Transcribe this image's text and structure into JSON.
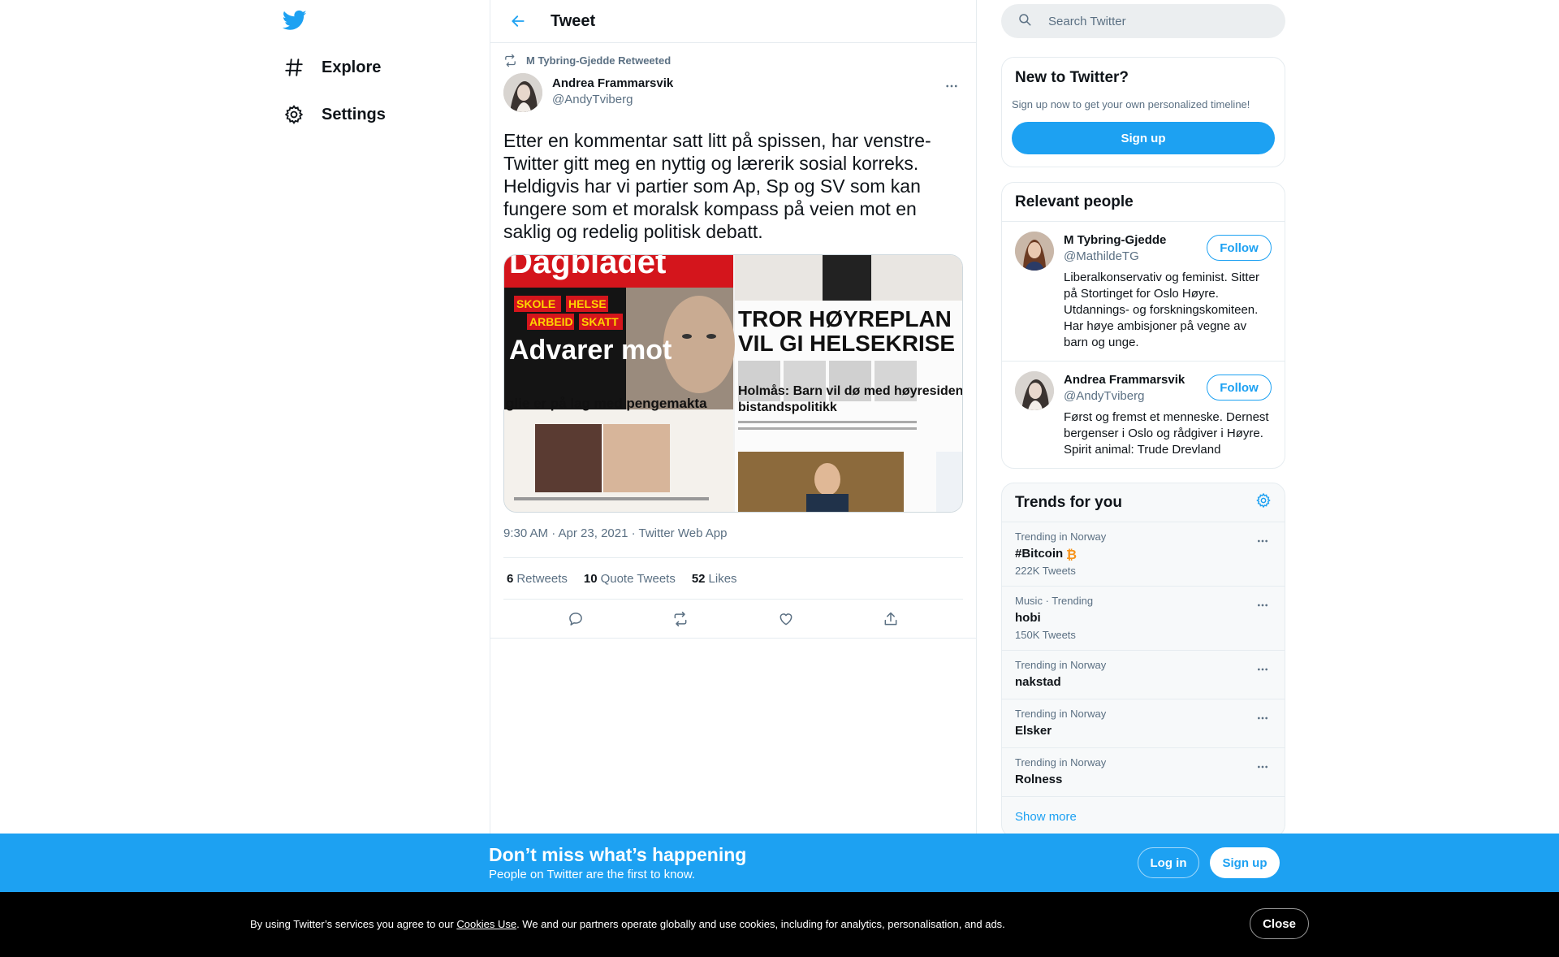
{
  "colors": {
    "brand": "#1da1f2",
    "text": "#0f1419",
    "secondary": "#5b7083",
    "border": "#e6ecf0",
    "bitcoin": "#f7931a"
  },
  "nav": {
    "logo_icon": "twitter-bird-icon",
    "items": [
      {
        "label": "Explore",
        "icon": "hashtag-icon"
      },
      {
        "label": "Settings",
        "icon": "gear-icon"
      }
    ]
  },
  "header": {
    "title": "Tweet",
    "back_icon": "back-arrow-icon"
  },
  "tweet": {
    "retweeted_by": "M Tybring-Gjedde Retweeted",
    "author_name": "Andrea Frammarsvik",
    "author_handle": "@AndyTviberg",
    "text": "Etter en kommentar satt litt på spissen, har venstre-Twitter gitt meg en nyttig og lærerik sosial korreks. Heldigvis har vi partier som Ap, Sp og SV som kan fungere som et moralsk kompass på veien mot en saklig og redelig politisk debatt.",
    "media": {
      "left_masthead": "Dagbladet",
      "left_tags": [
        "SKOLE",
        "HELSE",
        "ARBEID",
        "SKATT"
      ],
      "left_headline": "Advarer mot",
      "left_sub": "glie er på lag med pengemakta",
      "right_headline_1": "TROR HØYREPLAN",
      "right_headline_2": "VIL GI HELSEKRISE",
      "right_sub_1": "Holmås: Barn vil dø med høyresidens",
      "right_sub_2": "bistandspolitikk"
    },
    "meta": "9:30 AM · Apr 23, 2021 · Twitter Web App",
    "stats": [
      {
        "count": "6",
        "label": "Retweets"
      },
      {
        "count": "10",
        "label": "Quote Tweets"
      },
      {
        "count": "52",
        "label": "Likes"
      }
    ]
  },
  "search": {
    "placeholder": "Search Twitter"
  },
  "new_to": {
    "title": "New to Twitter?",
    "subtitle": "Sign up now to get your own personalized timeline!",
    "button": "Sign up"
  },
  "relevant": {
    "title": "Relevant people",
    "people": [
      {
        "name": "M Tybring-Gjedde",
        "handle": "@MathildeTG",
        "bio": "Liberalkonservativ og feminist. Sitter på Stortinget for Oslo Høyre. Utdannings- og forskningskomiteen. Har høye ambisjoner på vegne av barn og unge.",
        "button": "Follow"
      },
      {
        "name": "Andrea Frammarsvik",
        "handle": "@AndyTviberg",
        "bio": "Først og fremst et menneske. Dernest bergenser i Oslo og rådgiver i Høyre. Spirit animal: Trude Drevland",
        "button": "Follow"
      }
    ]
  },
  "trends": {
    "title": "Trends for you",
    "items": [
      {
        "context": "Trending in Norway",
        "name": "#Bitcoin",
        "count": "222K Tweets"
      },
      {
        "context": "Music · Trending",
        "name": "hobi",
        "count": "150K Tweets"
      },
      {
        "context": "Trending in Norway",
        "name": "nakstad",
        "count": ""
      },
      {
        "context": "Trending in Norway",
        "name": "Elsker",
        "count": ""
      },
      {
        "context": "Trending in Norway",
        "name": "Rolness",
        "count": ""
      }
    ],
    "show_more": "Show more"
  },
  "banner": {
    "title": "Don’t miss what’s happening",
    "subtitle": "People on Twitter are the first to know.",
    "login": "Log in",
    "signup": "Sign up"
  },
  "cookie": {
    "text_before": "By using Twitter’s services you agree to our ",
    "link": "Cookies Use",
    "text_after": ". We and our partners operate globally and use cookies, including for analytics, personalisation, and ads.",
    "close": "Close"
  }
}
